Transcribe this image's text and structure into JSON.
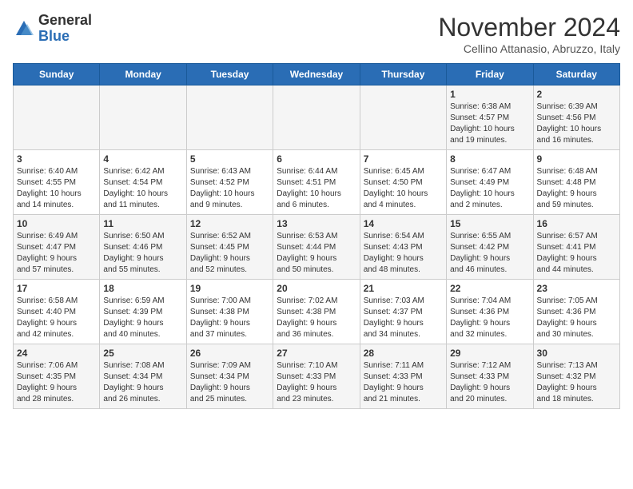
{
  "header": {
    "logo_general": "General",
    "logo_blue": "Blue",
    "title": "November 2024",
    "subtitle": "Cellino Attanasio, Abruzzo, Italy"
  },
  "weekdays": [
    "Sunday",
    "Monday",
    "Tuesday",
    "Wednesday",
    "Thursday",
    "Friday",
    "Saturday"
  ],
  "weeks": [
    [
      {
        "day": "",
        "info": ""
      },
      {
        "day": "",
        "info": ""
      },
      {
        "day": "",
        "info": ""
      },
      {
        "day": "",
        "info": ""
      },
      {
        "day": "",
        "info": ""
      },
      {
        "day": "1",
        "info": "Sunrise: 6:38 AM\nSunset: 4:57 PM\nDaylight: 10 hours\nand 19 minutes."
      },
      {
        "day": "2",
        "info": "Sunrise: 6:39 AM\nSunset: 4:56 PM\nDaylight: 10 hours\nand 16 minutes."
      }
    ],
    [
      {
        "day": "3",
        "info": "Sunrise: 6:40 AM\nSunset: 4:55 PM\nDaylight: 10 hours\nand 14 minutes."
      },
      {
        "day": "4",
        "info": "Sunrise: 6:42 AM\nSunset: 4:54 PM\nDaylight: 10 hours\nand 11 minutes."
      },
      {
        "day": "5",
        "info": "Sunrise: 6:43 AM\nSunset: 4:52 PM\nDaylight: 10 hours\nand 9 minutes."
      },
      {
        "day": "6",
        "info": "Sunrise: 6:44 AM\nSunset: 4:51 PM\nDaylight: 10 hours\nand 6 minutes."
      },
      {
        "day": "7",
        "info": "Sunrise: 6:45 AM\nSunset: 4:50 PM\nDaylight: 10 hours\nand 4 minutes."
      },
      {
        "day": "8",
        "info": "Sunrise: 6:47 AM\nSunset: 4:49 PM\nDaylight: 10 hours\nand 2 minutes."
      },
      {
        "day": "9",
        "info": "Sunrise: 6:48 AM\nSunset: 4:48 PM\nDaylight: 9 hours\nand 59 minutes."
      }
    ],
    [
      {
        "day": "10",
        "info": "Sunrise: 6:49 AM\nSunset: 4:47 PM\nDaylight: 9 hours\nand 57 minutes."
      },
      {
        "day": "11",
        "info": "Sunrise: 6:50 AM\nSunset: 4:46 PM\nDaylight: 9 hours\nand 55 minutes."
      },
      {
        "day": "12",
        "info": "Sunrise: 6:52 AM\nSunset: 4:45 PM\nDaylight: 9 hours\nand 52 minutes."
      },
      {
        "day": "13",
        "info": "Sunrise: 6:53 AM\nSunset: 4:44 PM\nDaylight: 9 hours\nand 50 minutes."
      },
      {
        "day": "14",
        "info": "Sunrise: 6:54 AM\nSunset: 4:43 PM\nDaylight: 9 hours\nand 48 minutes."
      },
      {
        "day": "15",
        "info": "Sunrise: 6:55 AM\nSunset: 4:42 PM\nDaylight: 9 hours\nand 46 minutes."
      },
      {
        "day": "16",
        "info": "Sunrise: 6:57 AM\nSunset: 4:41 PM\nDaylight: 9 hours\nand 44 minutes."
      }
    ],
    [
      {
        "day": "17",
        "info": "Sunrise: 6:58 AM\nSunset: 4:40 PM\nDaylight: 9 hours\nand 42 minutes."
      },
      {
        "day": "18",
        "info": "Sunrise: 6:59 AM\nSunset: 4:39 PM\nDaylight: 9 hours\nand 40 minutes."
      },
      {
        "day": "19",
        "info": "Sunrise: 7:00 AM\nSunset: 4:38 PM\nDaylight: 9 hours\nand 37 minutes."
      },
      {
        "day": "20",
        "info": "Sunrise: 7:02 AM\nSunset: 4:38 PM\nDaylight: 9 hours\nand 36 minutes."
      },
      {
        "day": "21",
        "info": "Sunrise: 7:03 AM\nSunset: 4:37 PM\nDaylight: 9 hours\nand 34 minutes."
      },
      {
        "day": "22",
        "info": "Sunrise: 7:04 AM\nSunset: 4:36 PM\nDaylight: 9 hours\nand 32 minutes."
      },
      {
        "day": "23",
        "info": "Sunrise: 7:05 AM\nSunset: 4:36 PM\nDaylight: 9 hours\nand 30 minutes."
      }
    ],
    [
      {
        "day": "24",
        "info": "Sunrise: 7:06 AM\nSunset: 4:35 PM\nDaylight: 9 hours\nand 28 minutes."
      },
      {
        "day": "25",
        "info": "Sunrise: 7:08 AM\nSunset: 4:34 PM\nDaylight: 9 hours\nand 26 minutes."
      },
      {
        "day": "26",
        "info": "Sunrise: 7:09 AM\nSunset: 4:34 PM\nDaylight: 9 hours\nand 25 minutes."
      },
      {
        "day": "27",
        "info": "Sunrise: 7:10 AM\nSunset: 4:33 PM\nDaylight: 9 hours\nand 23 minutes."
      },
      {
        "day": "28",
        "info": "Sunrise: 7:11 AM\nSunset: 4:33 PM\nDaylight: 9 hours\nand 21 minutes."
      },
      {
        "day": "29",
        "info": "Sunrise: 7:12 AM\nSunset: 4:33 PM\nDaylight: 9 hours\nand 20 minutes."
      },
      {
        "day": "30",
        "info": "Sunrise: 7:13 AM\nSunset: 4:32 PM\nDaylight: 9 hours\nand 18 minutes."
      }
    ]
  ]
}
